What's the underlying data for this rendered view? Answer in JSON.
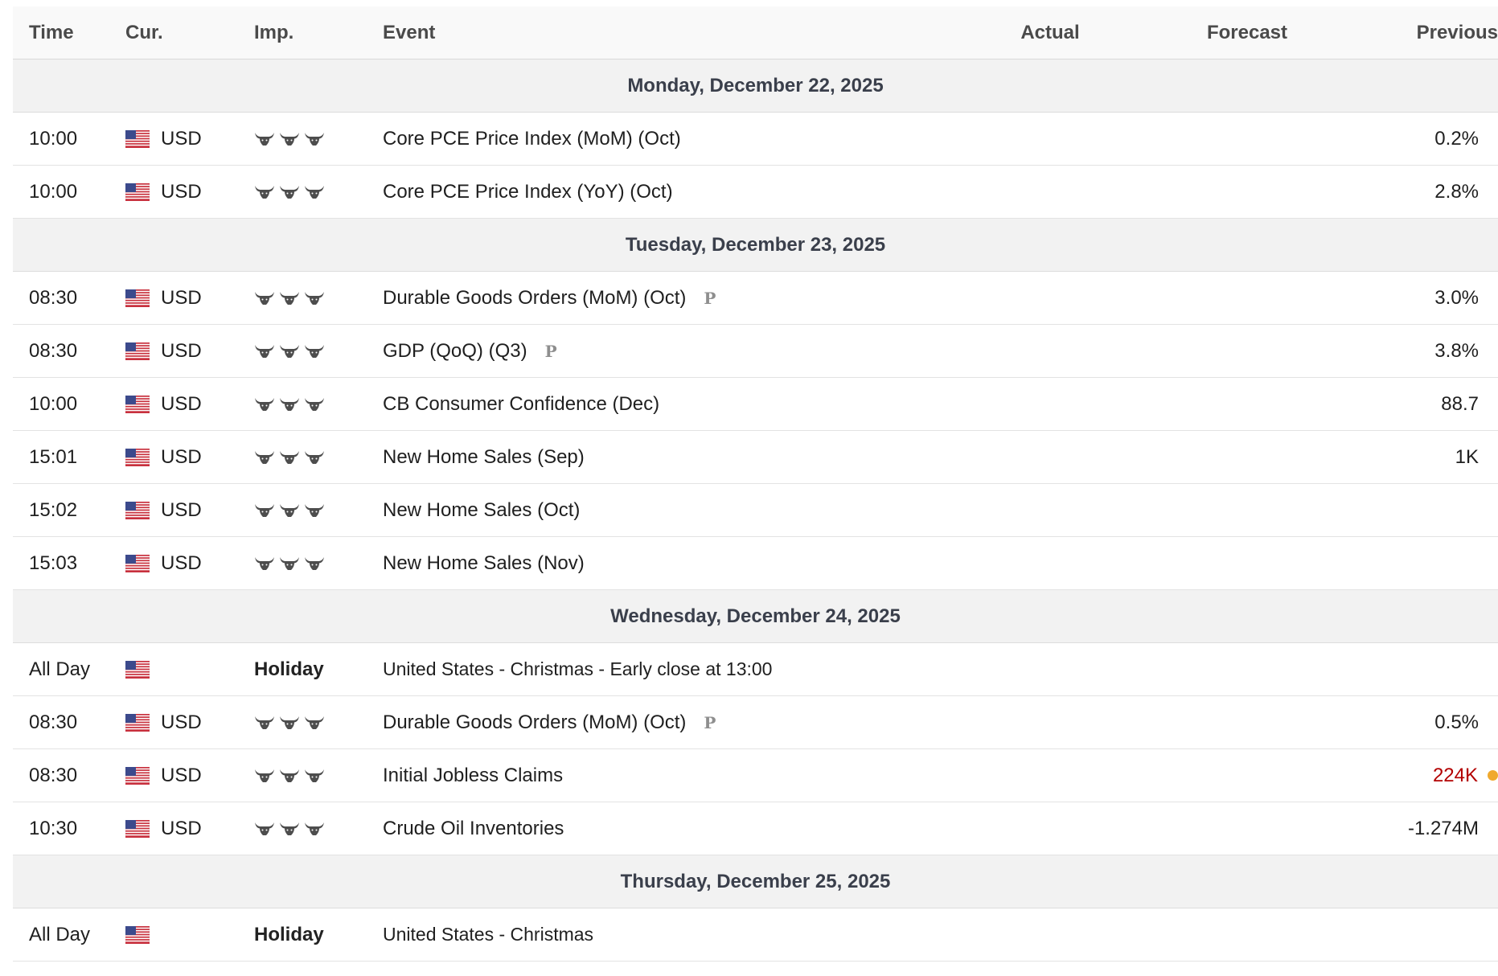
{
  "header": {
    "time": "Time",
    "currency": "Cur.",
    "importance": "Imp.",
    "event": "Event",
    "actual": "Actual",
    "forecast": "Forecast",
    "previous": "Previous"
  },
  "colors": {
    "worse_than_expected": "#b30000",
    "revised_dot": "#f0a92e",
    "day_row_bg": "#f2f2f2"
  },
  "days": [
    {
      "label": "Monday, December 22, 2025",
      "events": [
        {
          "time": "10:00",
          "currency": "USD",
          "flag": "us-flag-icon",
          "importance": 3,
          "event": "Core PCE Price Index (MoM) (Oct)",
          "preliminary": "",
          "actual": "",
          "forecast": "",
          "previous": "0.2%"
        },
        {
          "time": "10:00",
          "currency": "USD",
          "flag": "us-flag-icon",
          "importance": 3,
          "event": "Core PCE Price Index (YoY) (Oct)",
          "preliminary": "",
          "actual": "",
          "forecast": "",
          "previous": "2.8%"
        }
      ]
    },
    {
      "label": "Tuesday, December 23, 2025",
      "events": [
        {
          "time": "08:30",
          "currency": "USD",
          "flag": "us-flag-icon",
          "importance": 3,
          "event": "Durable Goods Orders (MoM) (Oct)",
          "preliminary": "P",
          "actual": "",
          "forecast": "",
          "previous": "3.0%"
        },
        {
          "time": "08:30",
          "currency": "USD",
          "flag": "us-flag-icon",
          "importance": 3,
          "event": "GDP (QoQ) (Q3)",
          "preliminary": "P",
          "actual": "",
          "forecast": "",
          "previous": "3.8%"
        },
        {
          "time": "10:00",
          "currency": "USD",
          "flag": "us-flag-icon",
          "importance": 3,
          "event": "CB Consumer Confidence (Dec)",
          "preliminary": "",
          "actual": "",
          "forecast": "",
          "previous": "88.7"
        },
        {
          "time": "15:01",
          "currency": "USD",
          "flag": "us-flag-icon",
          "importance": 3,
          "event": "New Home Sales (Sep)",
          "preliminary": "",
          "actual": "",
          "forecast": "",
          "previous": "1K"
        },
        {
          "time": "15:02",
          "currency": "USD",
          "flag": "us-flag-icon",
          "importance": 3,
          "event": "New Home Sales (Oct)",
          "preliminary": "",
          "actual": "",
          "forecast": "",
          "previous": ""
        },
        {
          "time": "15:03",
          "currency": "USD",
          "flag": "us-flag-icon",
          "importance": 3,
          "event": "New Home Sales (Nov)",
          "preliminary": "",
          "actual": "",
          "forecast": "",
          "previous": ""
        }
      ]
    },
    {
      "label": "Wednesday, December 24, 2025",
      "events": [
        {
          "time": "All Day",
          "currency": "",
          "flag": "us-flag-icon",
          "holiday": "Holiday",
          "event": "United States - Christmas - Early close at 13:00",
          "preliminary": "",
          "actual": "",
          "forecast": "",
          "previous": ""
        },
        {
          "time": "08:30",
          "currency": "USD",
          "flag": "us-flag-icon",
          "importance": 3,
          "event": "Durable Goods Orders (MoM) (Oct)",
          "preliminary": "P",
          "actual": "",
          "forecast": "",
          "previous": "0.5%"
        },
        {
          "time": "08:30",
          "currency": "USD",
          "flag": "us-flag-icon",
          "importance": 3,
          "event": "Initial Jobless Claims",
          "preliminary": "",
          "actual": "",
          "forecast": "",
          "previous": "224K",
          "previous_status": "worse",
          "revised": true
        },
        {
          "time": "10:30",
          "currency": "USD",
          "flag": "us-flag-icon",
          "importance": 3,
          "event": "Crude Oil Inventories",
          "preliminary": "",
          "actual": "",
          "forecast": "",
          "previous": "-1.274M"
        }
      ]
    },
    {
      "label": "Thursday, December 25, 2025",
      "events": [
        {
          "time": "All Day",
          "currency": "",
          "flag": "us-flag-icon",
          "holiday": "Holiday",
          "event": "United States - Christmas",
          "preliminary": "",
          "actual": "",
          "forecast": "",
          "previous": ""
        }
      ]
    }
  ]
}
